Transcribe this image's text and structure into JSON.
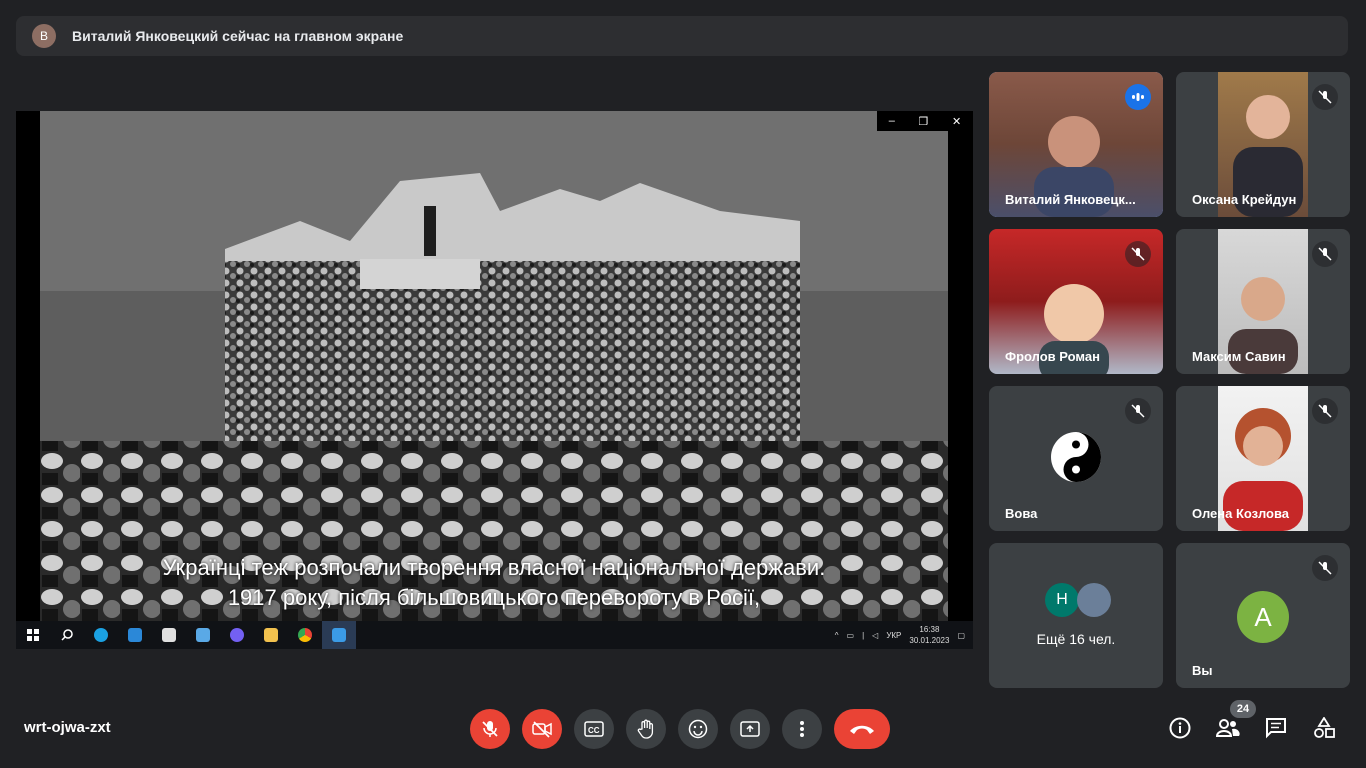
{
  "banner": {
    "avatar_letter": "В",
    "text": "Виталий Янковецкий сейчас на главном экране"
  },
  "presentation": {
    "subtitle_line1": "Українці теж розпочали творення власної національної держави.",
    "subtitle_line2": "1917 року, після більшовицького перевороту в Росії,",
    "taskbar": {
      "language": "УКР",
      "time": "16:38",
      "date": "30.01.2023"
    }
  },
  "participants": [
    {
      "name": "Виталий Янковецк...",
      "state": "speaking"
    },
    {
      "name": "Оксана Крейдун",
      "state": "muted"
    },
    {
      "name": "Фролов Роман",
      "state": "muted"
    },
    {
      "name": "Максим Савин",
      "state": "muted"
    },
    {
      "name": "Вова",
      "state": "muted"
    },
    {
      "name": "Олена Козлова",
      "state": "muted"
    }
  ],
  "more": {
    "avatar_letter": "Н",
    "label": "Ещё 16 чел."
  },
  "self": {
    "avatar_letter": "А",
    "name": "Вы"
  },
  "meeting_code": "wrt-ojwa-zxt",
  "people_count": "24",
  "colors": {
    "end_call": "#ea4335",
    "active_border": "#8ab4f8",
    "self_avatar": "#7cb342",
    "more_avatar": "#00796b"
  }
}
